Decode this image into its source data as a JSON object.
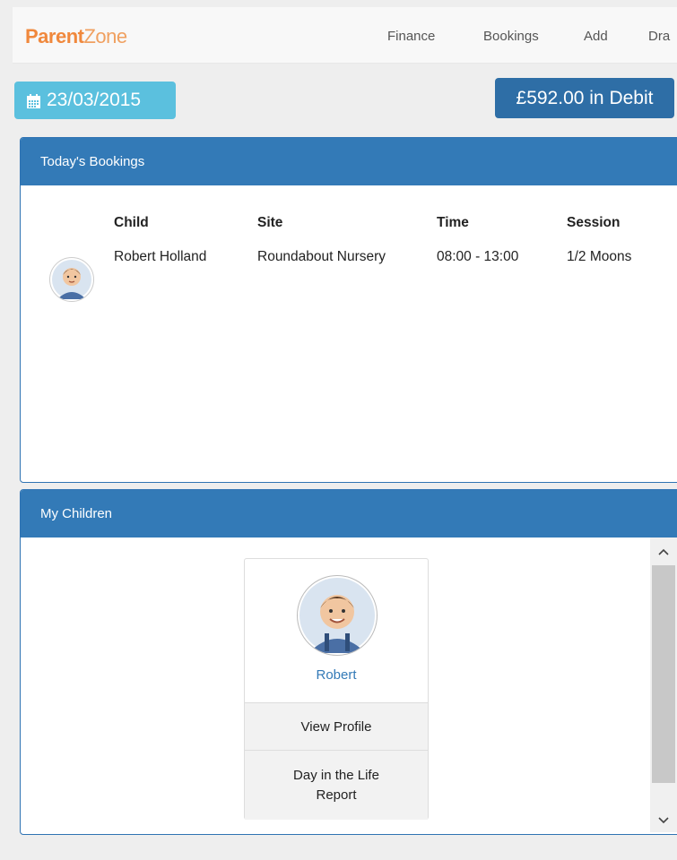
{
  "brand": {
    "part1": "Parent",
    "part2": "Zone"
  },
  "nav": [
    "Finance",
    "Bookings",
    "Add",
    "Dra"
  ],
  "date": "23/03/2015",
  "balance": "£592.00 in Debit",
  "bookings": {
    "title": "Today's Bookings",
    "headers": [
      "Child",
      "Site",
      "Time",
      "Session"
    ],
    "rows": [
      {
        "child": "Robert Holland",
        "site": "Roundabout Nursery",
        "time": "08:00 - 13:00",
        "session": "1/2 Moons"
      }
    ]
  },
  "children": {
    "title": "My Children",
    "items": [
      {
        "name": "Robert",
        "view_profile": "View Profile",
        "report_line1": "Day in the Life",
        "report_line2": "Report"
      }
    ]
  },
  "colors": {
    "primary": "#337ab7",
    "info": "#5bc0de",
    "brand_orange": "#f0883c"
  },
  "icons": [
    "calendar-icon",
    "scroll-up-arrow-icon",
    "scroll-down-arrow-icon"
  ]
}
